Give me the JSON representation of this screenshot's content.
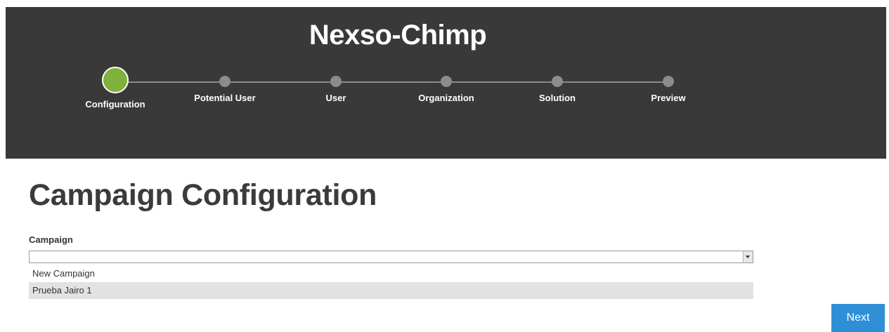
{
  "header": {
    "title": "Nexso-Chimp"
  },
  "stepper": {
    "steps": [
      {
        "label": "Configuration",
        "state": "active"
      },
      {
        "label": "Potential User",
        "state": "inactive"
      },
      {
        "label": "User",
        "state": "inactive"
      },
      {
        "label": "Organization",
        "state": "inactive"
      },
      {
        "label": "Solution",
        "state": "inactive"
      },
      {
        "label": "Preview",
        "state": "inactive"
      }
    ],
    "active_color": "#7fb23d",
    "inactive_color": "#8c8c8c"
  },
  "main": {
    "title": "Campaign Configuration",
    "campaign_field": {
      "label": "Campaign",
      "value": "",
      "options": [
        {
          "label": "New Campaign",
          "highlighted": false
        },
        {
          "label": "Prueba Jairo 1",
          "highlighted": true
        }
      ]
    },
    "next_label": "Next"
  },
  "colors": {
    "header_bg": "#393939",
    "accent": "#2f8fd6"
  }
}
